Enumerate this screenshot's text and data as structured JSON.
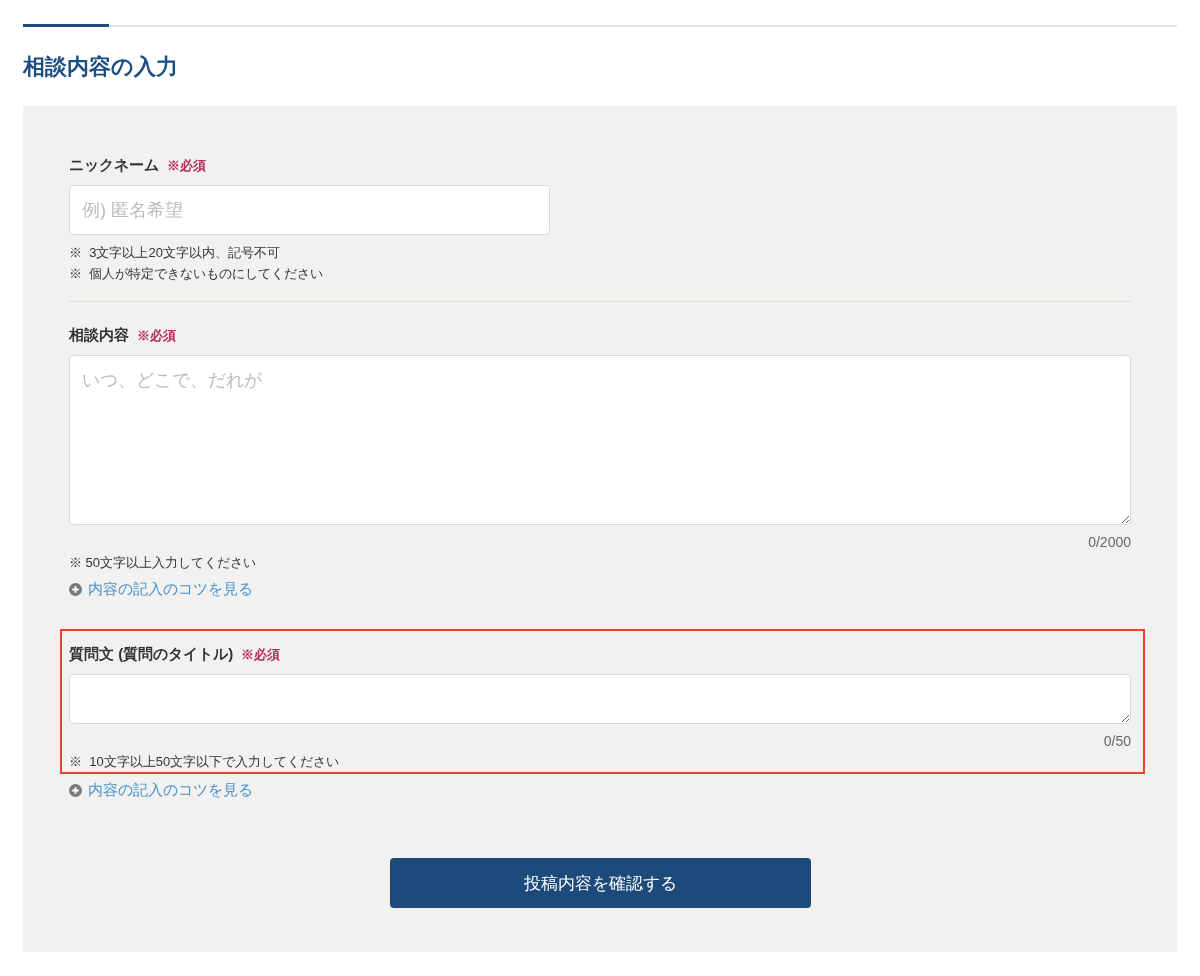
{
  "title": "相談内容の入力",
  "fields": [
    {
      "kind": "text-input",
      "label": "ニックネーム",
      "required_label": "※必須",
      "placeholder": "例) 匿名希望",
      "notes": [
        "※  3文字以上20文字以内、記号不可",
        "※  個人が特定できないものにしてください"
      ],
      "divider_below": true,
      "highlighted": false
    },
    {
      "kind": "long-textarea",
      "label": "相談内容",
      "required_label": "※必須",
      "placeholder": "いつ、どこで、だれが",
      "counter": "0/2000",
      "notes": [
        "※ 50文字以上入力してください"
      ],
      "tip_link": "内容の記入のコツを見る",
      "divider_below": false,
      "highlighted": false
    },
    {
      "kind": "short-textarea",
      "label": "質問文 (質問のタイトル)",
      "required_label": "※必須",
      "counter": "0/50",
      "notes": [
        "※  10文字以上50文字以下で入力してください"
      ],
      "tip_link": "内容の記入のコツを見る",
      "divider_below": false,
      "highlighted": true
    }
  ],
  "submit_button": "投稿内容を確認する"
}
